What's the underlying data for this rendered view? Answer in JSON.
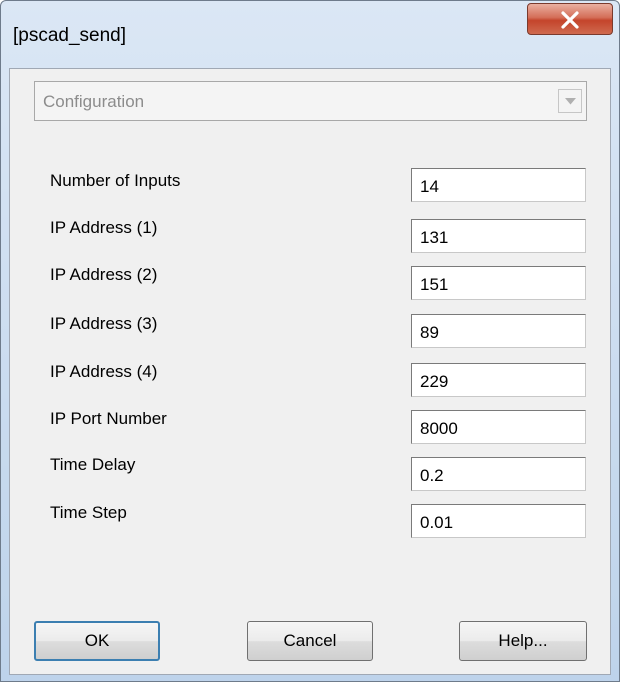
{
  "window": {
    "title": "[pscad_send]",
    "close_glyph": "close-icon"
  },
  "combo": {
    "selected": "Configuration"
  },
  "rows": [
    {
      "label": "Number of Inputs",
      "value": "14"
    },
    {
      "label": "IP Address (1)",
      "value": "131"
    },
    {
      "label": "IP Address (2)",
      "value": "151"
    },
    {
      "label": "IP Address (3)",
      "value": "89"
    },
    {
      "label": "IP Address (4)",
      "value": "229"
    },
    {
      "label": "IP Port Number",
      "value": "8000"
    },
    {
      "label": "Time Delay",
      "value": "0.2"
    },
    {
      "label": "Time Step",
      "value": "0.01"
    }
  ],
  "buttons": {
    "ok": "OK",
    "cancel": "Cancel",
    "help": "Help..."
  },
  "colors": {
    "close_button": "#c4442b",
    "default_button_border": "#3c7fb1"
  }
}
